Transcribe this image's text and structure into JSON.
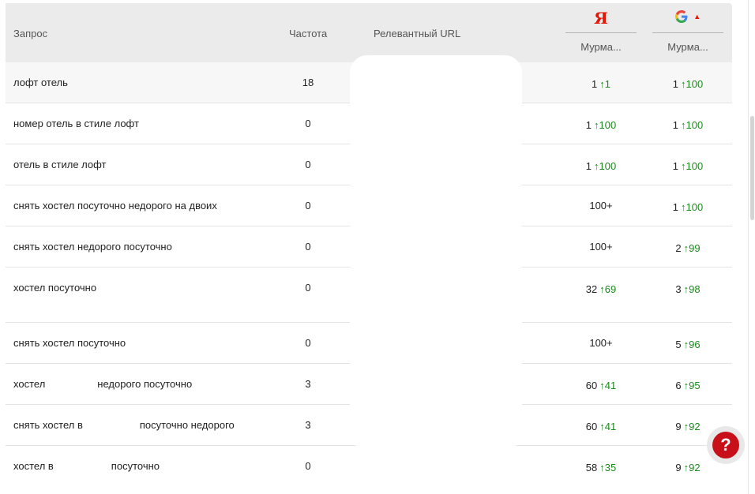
{
  "header": {
    "query": "Запрос",
    "frequency": "Частота",
    "url": "Релевантный URL",
    "yandex_logo": "Я",
    "yandex_region": "Мурма...",
    "google_region": "Мурма...",
    "google_logo_icon": "google-g-icon",
    "sort_icon": "caret-up-icon"
  },
  "rows": [
    {
      "query": "лофт отель",
      "frequency": "18",
      "yandex_pos": "1",
      "yandex_delta": "1",
      "google_pos": "1",
      "google_delta": "100"
    },
    {
      "query": "номер отель в стиле лофт",
      "frequency": "0",
      "yandex_pos": "1",
      "yandex_delta": "100",
      "google_pos": "1",
      "google_delta": "100"
    },
    {
      "query": "отель в стиле лофт",
      "frequency": "0",
      "yandex_pos": "1",
      "yandex_delta": "100",
      "google_pos": "1",
      "google_delta": "100"
    },
    {
      "query": "снять хостел посуточно недорого на двоих",
      "frequency": "0",
      "yandex_pos": "100+",
      "yandex_delta": "",
      "google_pos": "1",
      "google_delta": "100"
    },
    {
      "query": "снять хостел недорого посуточно",
      "frequency": "0",
      "yandex_pos": "100+",
      "yandex_delta": "",
      "google_pos": "2",
      "google_delta": "99"
    },
    {
      "query": "хостел посуточно",
      "frequency": "0",
      "yandex_pos": "32",
      "yandex_delta": "69",
      "google_pos": "3",
      "google_delta": "98"
    },
    {
      "query": "снять хостел посуточно",
      "frequency": "0",
      "yandex_pos": "100+",
      "yandex_delta": "",
      "google_pos": "5",
      "google_delta": "96"
    },
    {
      "query_a": "хостел",
      "query_b": "недорого посуточно",
      "frequency": "3",
      "yandex_pos": "60",
      "yandex_delta": "41",
      "google_pos": "6",
      "google_delta": "95"
    },
    {
      "query_a": "снять хостел в",
      "query_b": "посуточно недорого",
      "frequency": "3",
      "yandex_pos": "60",
      "yandex_delta": "41",
      "google_pos": "9",
      "google_delta": "92"
    },
    {
      "query_a": "хостел в",
      "query_b": "посуточно",
      "frequency": "0",
      "yandex_pos": "58",
      "yandex_delta": "35",
      "google_pos": "9",
      "google_delta": "92"
    }
  ],
  "help": {
    "label": "?",
    "icon": "question-icon"
  },
  "colors": {
    "up": "#1a8a1a",
    "yandex": "#e61400",
    "help": "#c8101a"
  }
}
